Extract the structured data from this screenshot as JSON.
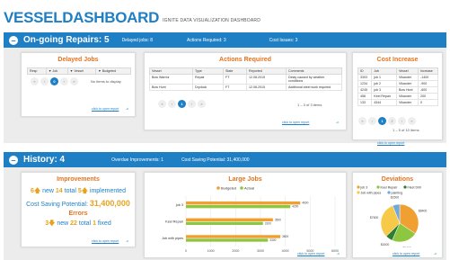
{
  "header": {
    "brand_a": "VESSEL",
    "brand_b": "DASHBOARD",
    "subtitle": "IGNITE DATA VISUALIZATION DASHBOARD"
  },
  "ongoing": {
    "title": "On-going Repairs: 5",
    "delayed": "Delayed jobs: 8",
    "actions": "Actions Required: 3",
    "cost": "Cost Issues: 3"
  },
  "delayed_jobs": {
    "title": "Delayed Jobs",
    "headers": [
      "Resp",
      "Job",
      "Vessel",
      "Budgeted"
    ],
    "empty": "No items to display",
    "pager": [
      "«",
      "‹",
      "0",
      "›",
      "»"
    ],
    "link": "click to open report"
  },
  "actions_required": {
    "title": "Actions Required",
    "headers": [
      "Vessel",
      "Type",
      "State",
      "Reported",
      "Comments"
    ],
    "rows": [
      [
        "Bow Warrior",
        "Repair",
        "FT",
        "12.08.2015",
        "Delay caused by weather conditions"
      ],
      [
        "Bow Hunt",
        "Drydock",
        "FT",
        "12.08.2015",
        "Additional steel work required"
      ]
    ],
    "pager": [
      "«",
      "‹",
      "1",
      "›",
      "»"
    ],
    "pager_info": "1 – 3 of 3 items",
    "link": "click to open report"
  },
  "cost_increase": {
    "title": "Cost Increase",
    "headers": [
      "ID",
      "Job",
      "Vessel",
      "Increase"
    ],
    "rows": [
      [
        "3303",
        "job 1",
        "Vikander",
        "-1400"
      ],
      [
        "1234",
        "job 2",
        "Vikander",
        "-900"
      ],
      [
        "4245",
        "job 3",
        "Bow Hunt",
        "-600"
      ],
      [
        "456",
        "Keel Repair",
        "Vikander",
        "200"
      ],
      [
        "133",
        "4344",
        "Vikander",
        "0"
      ]
    ],
    "pager": [
      "«",
      "‹",
      "1",
      "2",
      "›",
      "»"
    ],
    "pager_info": "1 – 5 of 10 items",
    "link": "click to open report"
  },
  "history": {
    "title": "History: 4",
    "overdue": "Overdue Improvements: 1",
    "saving": "Cost Saving Potential: 31,400,000"
  },
  "improvements": {
    "title": "Improvements",
    "new_count": "6",
    "new_label": "new",
    "total_count": "14",
    "total_label": "total",
    "impl_count": "5",
    "impl_label": "implemented",
    "saving_label": "Cost Saving Potential:",
    "saving_value": "31,400,000",
    "errors_title": "Errors",
    "err_new": "3",
    "err_new_label": "new",
    "err_total": "22",
    "err_total_label": "total",
    "err_fixed": "1",
    "err_fixed_label": "fixed",
    "link": "click to open report"
  },
  "large_jobs": {
    "title": "Large Jobs",
    "link": "click to open report",
    "chart_data": {
      "type": "bar",
      "orientation": "horizontal",
      "categories": [
        "job 3",
        "Keel Repair",
        "Job with pipes"
      ],
      "series": [
        {
          "name": "Budgeted",
          "color": "#f0a030",
          "values": [
            4600,
            3500,
            3800
          ]
        },
        {
          "name": "Actual",
          "color": "#8dc63f",
          "values": [
            4200,
            3100,
            3300
          ]
        }
      ],
      "data_labels": [
        "4600",
        "4200",
        "3500",
        "3100",
        "3800",
        "3300"
      ],
      "xticks": [
        "0",
        "1000",
        "2000",
        "3000",
        "4000",
        "5000",
        "6000"
      ],
      "xlim": [
        0,
        6000
      ],
      "legend": "top"
    }
  },
  "deviations": {
    "title": "Deviations",
    "link": "click to open report",
    "chart_data": {
      "type": "pie",
      "slices": [
        {
          "name": "job 3",
          "value": 8400,
          "color": "#f0a030"
        },
        {
          "name": "Keel Repair",
          "value": 5400,
          "color": "#8dc63f"
        },
        {
          "name": "Fleet Drill",
          "value": 1500,
          "color": "#2e7d32"
        },
        {
          "name": "Job with pipes",
          "value": 7600,
          "color": "#f7c948"
        },
        {
          "name": "painting",
          "value": 1500,
          "color": "#6fa8dc"
        }
      ],
      "data_labels": [
        "$8400",
        "$7600",
        "$5400",
        "$1500",
        "$1500"
      ],
      "legend": "top"
    }
  }
}
